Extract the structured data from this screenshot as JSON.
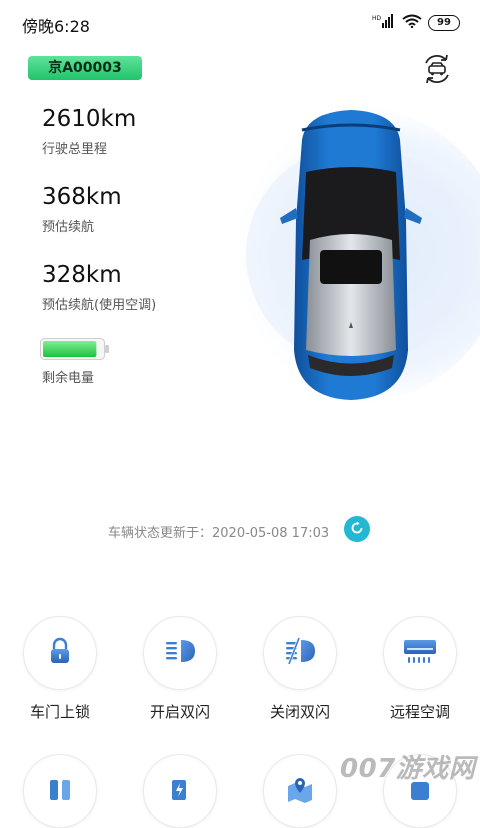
{
  "status_bar": {
    "time": "傍晚6:28",
    "battery": "99",
    "network_badge": "HD"
  },
  "vehicle": {
    "plate": "京A00003"
  },
  "stats": [
    {
      "value": "2610km",
      "label": "行驶总里程"
    },
    {
      "value": "368km",
      "label": "预估续航"
    },
    {
      "value": "328km",
      "label": "预估续航(使用空调)"
    }
  ],
  "battery": {
    "label": "剩余电量",
    "level": 0.92,
    "fill_color": "#2ed35a"
  },
  "update": {
    "text": "车辆状态更新于：2020-05-08 17:03"
  },
  "actions": [
    {
      "label": "车门上锁",
      "icon": "lock-icon"
    },
    {
      "label": "开启双闪",
      "icon": "hazard-on-icon"
    },
    {
      "label": "关闭双闪",
      "icon": "hazard-off-icon"
    },
    {
      "label": "远程空调",
      "icon": "air-conditioner-icon"
    }
  ],
  "actions_row2_icons": [
    "charging-icon",
    "charging-station-icon",
    "map-pin-icon",
    "more-icon"
  ],
  "watermark": "007游戏网",
  "colors": {
    "accent": "#22b7d3",
    "plate_green": "#21c36c",
    "icon_blue": "#3a7fd0"
  }
}
